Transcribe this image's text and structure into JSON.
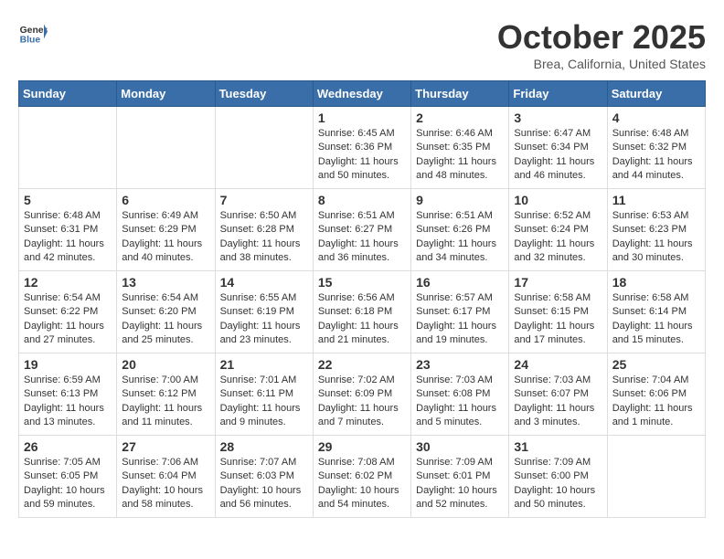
{
  "header": {
    "logo_general": "General",
    "logo_blue": "Blue",
    "month_title": "October 2025",
    "location": "Brea, California, United States"
  },
  "weekdays": [
    "Sunday",
    "Monday",
    "Tuesday",
    "Wednesday",
    "Thursday",
    "Friday",
    "Saturday"
  ],
  "weeks": [
    [
      {
        "day": "",
        "info": ""
      },
      {
        "day": "",
        "info": ""
      },
      {
        "day": "",
        "info": ""
      },
      {
        "day": "1",
        "info": "Sunrise: 6:45 AM\nSunset: 6:36 PM\nDaylight: 11 hours\nand 50 minutes."
      },
      {
        "day": "2",
        "info": "Sunrise: 6:46 AM\nSunset: 6:35 PM\nDaylight: 11 hours\nand 48 minutes."
      },
      {
        "day": "3",
        "info": "Sunrise: 6:47 AM\nSunset: 6:34 PM\nDaylight: 11 hours\nand 46 minutes."
      },
      {
        "day": "4",
        "info": "Sunrise: 6:48 AM\nSunset: 6:32 PM\nDaylight: 11 hours\nand 44 minutes."
      }
    ],
    [
      {
        "day": "5",
        "info": "Sunrise: 6:48 AM\nSunset: 6:31 PM\nDaylight: 11 hours\nand 42 minutes."
      },
      {
        "day": "6",
        "info": "Sunrise: 6:49 AM\nSunset: 6:29 PM\nDaylight: 11 hours\nand 40 minutes."
      },
      {
        "day": "7",
        "info": "Sunrise: 6:50 AM\nSunset: 6:28 PM\nDaylight: 11 hours\nand 38 minutes."
      },
      {
        "day": "8",
        "info": "Sunrise: 6:51 AM\nSunset: 6:27 PM\nDaylight: 11 hours\nand 36 minutes."
      },
      {
        "day": "9",
        "info": "Sunrise: 6:51 AM\nSunset: 6:26 PM\nDaylight: 11 hours\nand 34 minutes."
      },
      {
        "day": "10",
        "info": "Sunrise: 6:52 AM\nSunset: 6:24 PM\nDaylight: 11 hours\nand 32 minutes."
      },
      {
        "day": "11",
        "info": "Sunrise: 6:53 AM\nSunset: 6:23 PM\nDaylight: 11 hours\nand 30 minutes."
      }
    ],
    [
      {
        "day": "12",
        "info": "Sunrise: 6:54 AM\nSunset: 6:22 PM\nDaylight: 11 hours\nand 27 minutes."
      },
      {
        "day": "13",
        "info": "Sunrise: 6:54 AM\nSunset: 6:20 PM\nDaylight: 11 hours\nand 25 minutes."
      },
      {
        "day": "14",
        "info": "Sunrise: 6:55 AM\nSunset: 6:19 PM\nDaylight: 11 hours\nand 23 minutes."
      },
      {
        "day": "15",
        "info": "Sunrise: 6:56 AM\nSunset: 6:18 PM\nDaylight: 11 hours\nand 21 minutes."
      },
      {
        "day": "16",
        "info": "Sunrise: 6:57 AM\nSunset: 6:17 PM\nDaylight: 11 hours\nand 19 minutes."
      },
      {
        "day": "17",
        "info": "Sunrise: 6:58 AM\nSunset: 6:15 PM\nDaylight: 11 hours\nand 17 minutes."
      },
      {
        "day": "18",
        "info": "Sunrise: 6:58 AM\nSunset: 6:14 PM\nDaylight: 11 hours\nand 15 minutes."
      }
    ],
    [
      {
        "day": "19",
        "info": "Sunrise: 6:59 AM\nSunset: 6:13 PM\nDaylight: 11 hours\nand 13 minutes."
      },
      {
        "day": "20",
        "info": "Sunrise: 7:00 AM\nSunset: 6:12 PM\nDaylight: 11 hours\nand 11 minutes."
      },
      {
        "day": "21",
        "info": "Sunrise: 7:01 AM\nSunset: 6:11 PM\nDaylight: 11 hours\nand 9 minutes."
      },
      {
        "day": "22",
        "info": "Sunrise: 7:02 AM\nSunset: 6:09 PM\nDaylight: 11 hours\nand 7 minutes."
      },
      {
        "day": "23",
        "info": "Sunrise: 7:03 AM\nSunset: 6:08 PM\nDaylight: 11 hours\nand 5 minutes."
      },
      {
        "day": "24",
        "info": "Sunrise: 7:03 AM\nSunset: 6:07 PM\nDaylight: 11 hours\nand 3 minutes."
      },
      {
        "day": "25",
        "info": "Sunrise: 7:04 AM\nSunset: 6:06 PM\nDaylight: 11 hours\nand 1 minute."
      }
    ],
    [
      {
        "day": "26",
        "info": "Sunrise: 7:05 AM\nSunset: 6:05 PM\nDaylight: 10 hours\nand 59 minutes."
      },
      {
        "day": "27",
        "info": "Sunrise: 7:06 AM\nSunset: 6:04 PM\nDaylight: 10 hours\nand 58 minutes."
      },
      {
        "day": "28",
        "info": "Sunrise: 7:07 AM\nSunset: 6:03 PM\nDaylight: 10 hours\nand 56 minutes."
      },
      {
        "day": "29",
        "info": "Sunrise: 7:08 AM\nSunset: 6:02 PM\nDaylight: 10 hours\nand 54 minutes."
      },
      {
        "day": "30",
        "info": "Sunrise: 7:09 AM\nSunset: 6:01 PM\nDaylight: 10 hours\nand 52 minutes."
      },
      {
        "day": "31",
        "info": "Sunrise: 7:09 AM\nSunset: 6:00 PM\nDaylight: 10 hours\nand 50 minutes."
      },
      {
        "day": "",
        "info": ""
      }
    ]
  ]
}
